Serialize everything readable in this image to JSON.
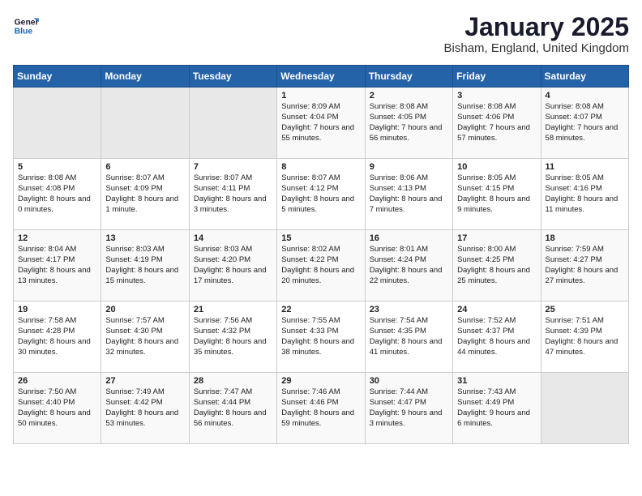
{
  "header": {
    "logo_general": "General",
    "logo_blue": "Blue",
    "month": "January 2025",
    "location": "Bisham, England, United Kingdom"
  },
  "days_of_week": [
    "Sunday",
    "Monday",
    "Tuesday",
    "Wednesday",
    "Thursday",
    "Friday",
    "Saturday"
  ],
  "weeks": [
    [
      {
        "day": "",
        "empty": true
      },
      {
        "day": "",
        "empty": true
      },
      {
        "day": "",
        "empty": true
      },
      {
        "day": "1",
        "sunrise": "Sunrise: 8:09 AM",
        "sunset": "Sunset: 4:04 PM",
        "daylight": "Daylight: 7 hours and 55 minutes."
      },
      {
        "day": "2",
        "sunrise": "Sunrise: 8:08 AM",
        "sunset": "Sunset: 4:05 PM",
        "daylight": "Daylight: 7 hours and 56 minutes."
      },
      {
        "day": "3",
        "sunrise": "Sunrise: 8:08 AM",
        "sunset": "Sunset: 4:06 PM",
        "daylight": "Daylight: 7 hours and 57 minutes."
      },
      {
        "day": "4",
        "sunrise": "Sunrise: 8:08 AM",
        "sunset": "Sunset: 4:07 PM",
        "daylight": "Daylight: 7 hours and 58 minutes."
      }
    ],
    [
      {
        "day": "5",
        "sunrise": "Sunrise: 8:08 AM",
        "sunset": "Sunset: 4:08 PM",
        "daylight": "Daylight: 8 hours and 0 minutes."
      },
      {
        "day": "6",
        "sunrise": "Sunrise: 8:07 AM",
        "sunset": "Sunset: 4:09 PM",
        "daylight": "Daylight: 8 hours and 1 minute."
      },
      {
        "day": "7",
        "sunrise": "Sunrise: 8:07 AM",
        "sunset": "Sunset: 4:11 PM",
        "daylight": "Daylight: 8 hours and 3 minutes."
      },
      {
        "day": "8",
        "sunrise": "Sunrise: 8:07 AM",
        "sunset": "Sunset: 4:12 PM",
        "daylight": "Daylight: 8 hours and 5 minutes."
      },
      {
        "day": "9",
        "sunrise": "Sunrise: 8:06 AM",
        "sunset": "Sunset: 4:13 PM",
        "daylight": "Daylight: 8 hours and 7 minutes."
      },
      {
        "day": "10",
        "sunrise": "Sunrise: 8:05 AM",
        "sunset": "Sunset: 4:15 PM",
        "daylight": "Daylight: 8 hours and 9 minutes."
      },
      {
        "day": "11",
        "sunrise": "Sunrise: 8:05 AM",
        "sunset": "Sunset: 4:16 PM",
        "daylight": "Daylight: 8 hours and 11 minutes."
      }
    ],
    [
      {
        "day": "12",
        "sunrise": "Sunrise: 8:04 AM",
        "sunset": "Sunset: 4:17 PM",
        "daylight": "Daylight: 8 hours and 13 minutes."
      },
      {
        "day": "13",
        "sunrise": "Sunrise: 8:03 AM",
        "sunset": "Sunset: 4:19 PM",
        "daylight": "Daylight: 8 hours and 15 minutes."
      },
      {
        "day": "14",
        "sunrise": "Sunrise: 8:03 AM",
        "sunset": "Sunset: 4:20 PM",
        "daylight": "Daylight: 8 hours and 17 minutes."
      },
      {
        "day": "15",
        "sunrise": "Sunrise: 8:02 AM",
        "sunset": "Sunset: 4:22 PM",
        "daylight": "Daylight: 8 hours and 20 minutes."
      },
      {
        "day": "16",
        "sunrise": "Sunrise: 8:01 AM",
        "sunset": "Sunset: 4:24 PM",
        "daylight": "Daylight: 8 hours and 22 minutes."
      },
      {
        "day": "17",
        "sunrise": "Sunrise: 8:00 AM",
        "sunset": "Sunset: 4:25 PM",
        "daylight": "Daylight: 8 hours and 25 minutes."
      },
      {
        "day": "18",
        "sunrise": "Sunrise: 7:59 AM",
        "sunset": "Sunset: 4:27 PM",
        "daylight": "Daylight: 8 hours and 27 minutes."
      }
    ],
    [
      {
        "day": "19",
        "sunrise": "Sunrise: 7:58 AM",
        "sunset": "Sunset: 4:28 PM",
        "daylight": "Daylight: 8 hours and 30 minutes."
      },
      {
        "day": "20",
        "sunrise": "Sunrise: 7:57 AM",
        "sunset": "Sunset: 4:30 PM",
        "daylight": "Daylight: 8 hours and 32 minutes."
      },
      {
        "day": "21",
        "sunrise": "Sunrise: 7:56 AM",
        "sunset": "Sunset: 4:32 PM",
        "daylight": "Daylight: 8 hours and 35 minutes."
      },
      {
        "day": "22",
        "sunrise": "Sunrise: 7:55 AM",
        "sunset": "Sunset: 4:33 PM",
        "daylight": "Daylight: 8 hours and 38 minutes."
      },
      {
        "day": "23",
        "sunrise": "Sunrise: 7:54 AM",
        "sunset": "Sunset: 4:35 PM",
        "daylight": "Daylight: 8 hours and 41 minutes."
      },
      {
        "day": "24",
        "sunrise": "Sunrise: 7:52 AM",
        "sunset": "Sunset: 4:37 PM",
        "daylight": "Daylight: 8 hours and 44 minutes."
      },
      {
        "day": "25",
        "sunrise": "Sunrise: 7:51 AM",
        "sunset": "Sunset: 4:39 PM",
        "daylight": "Daylight: 8 hours and 47 minutes."
      }
    ],
    [
      {
        "day": "26",
        "sunrise": "Sunrise: 7:50 AM",
        "sunset": "Sunset: 4:40 PM",
        "daylight": "Daylight: 8 hours and 50 minutes."
      },
      {
        "day": "27",
        "sunrise": "Sunrise: 7:49 AM",
        "sunset": "Sunset: 4:42 PM",
        "daylight": "Daylight: 8 hours and 53 minutes."
      },
      {
        "day": "28",
        "sunrise": "Sunrise: 7:47 AM",
        "sunset": "Sunset: 4:44 PM",
        "daylight": "Daylight: 8 hours and 56 minutes."
      },
      {
        "day": "29",
        "sunrise": "Sunrise: 7:46 AM",
        "sunset": "Sunset: 4:46 PM",
        "daylight": "Daylight: 8 hours and 59 minutes."
      },
      {
        "day": "30",
        "sunrise": "Sunrise: 7:44 AM",
        "sunset": "Sunset: 4:47 PM",
        "daylight": "Daylight: 9 hours and 3 minutes."
      },
      {
        "day": "31",
        "sunrise": "Sunrise: 7:43 AM",
        "sunset": "Sunset: 4:49 PM",
        "daylight": "Daylight: 9 hours and 6 minutes."
      },
      {
        "day": "",
        "empty": true
      }
    ]
  ]
}
